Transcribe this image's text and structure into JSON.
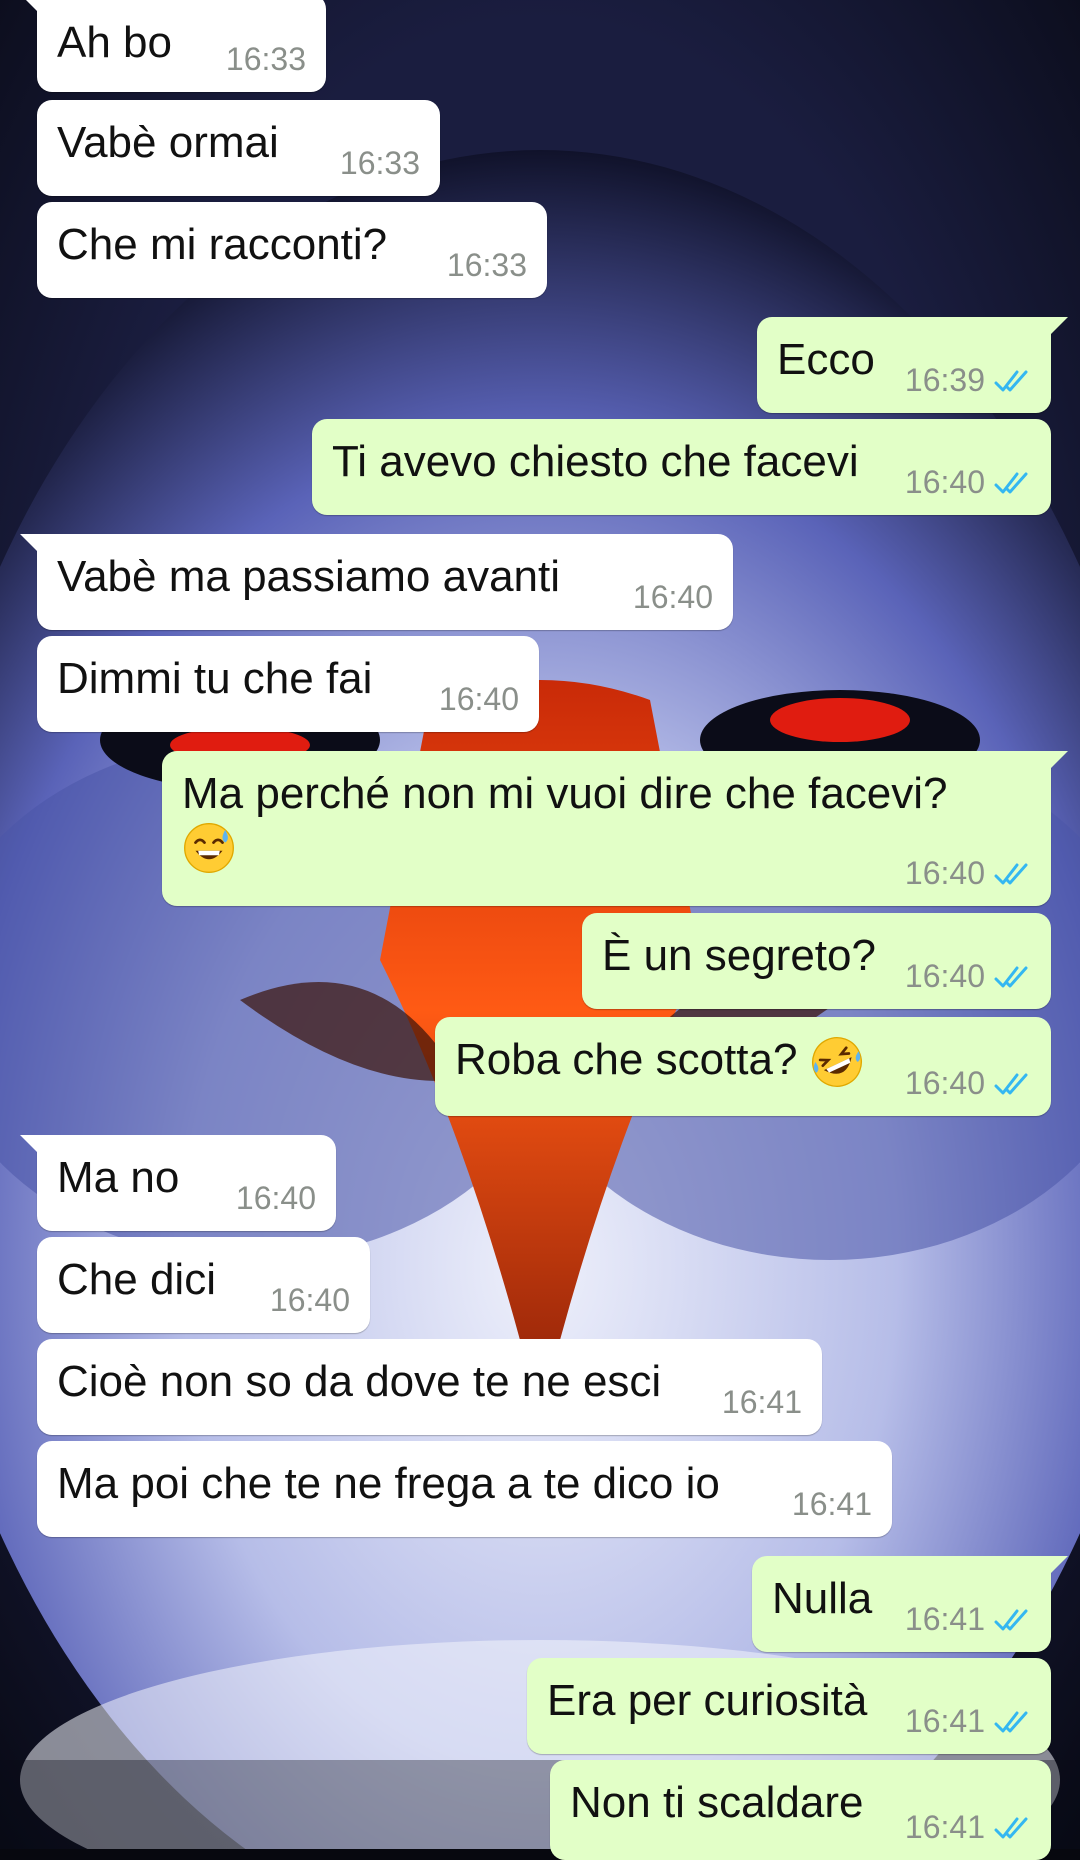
{
  "colors": {
    "incoming_bubble": "#ffffff",
    "outgoing_bubble": "#e2ffc7",
    "timestamp": "#8a8f8a",
    "read_ticks": "#34b7f1"
  },
  "wallpaper": {
    "subject": "eagle-head"
  },
  "messages": [
    {
      "dir": "in",
      "text": "Ah bo",
      "time": "16:33"
    },
    {
      "dir": "in",
      "text": "Vabè ormai",
      "time": "16:33"
    },
    {
      "dir": "in",
      "text": "Che mi racconti?",
      "time": "16:33"
    },
    {
      "dir": "out",
      "text": "Ecco",
      "time": "16:39",
      "status": "read"
    },
    {
      "dir": "out",
      "text": "Ti avevo chiesto che facevi",
      "time": "16:40",
      "status": "read"
    },
    {
      "dir": "in",
      "text": "Vabè ma passiamo avanti",
      "time": "16:40"
    },
    {
      "dir": "in",
      "text": "Dimmi tu che fai",
      "time": "16:40"
    },
    {
      "dir": "out",
      "text": "Ma perché non mi vuoi dire che facevi?",
      "emoji": "sweat-smile",
      "time": "16:40",
      "status": "read"
    },
    {
      "dir": "out",
      "text": "È un segreto?",
      "time": "16:40",
      "status": "read"
    },
    {
      "dir": "out",
      "text": "Roba che scotta?",
      "emoji": "rofl",
      "time": "16:40",
      "status": "read"
    },
    {
      "dir": "in",
      "text": "Ma no",
      "time": "16:40"
    },
    {
      "dir": "in",
      "text": "Che dici",
      "time": "16:40"
    },
    {
      "dir": "in",
      "text": "Cioè non so da dove te ne esci",
      "time": "16:41"
    },
    {
      "dir": "in",
      "text": "Ma poi che te ne frega a te dico io",
      "time": "16:41"
    },
    {
      "dir": "out",
      "text": "Nulla",
      "time": "16:41",
      "status": "read"
    },
    {
      "dir": "out",
      "text": "Era per curiosità",
      "time": "16:41",
      "status": "read"
    },
    {
      "dir": "out",
      "text": "Non ti scaldare",
      "time": "16:41",
      "status": "read"
    }
  ]
}
